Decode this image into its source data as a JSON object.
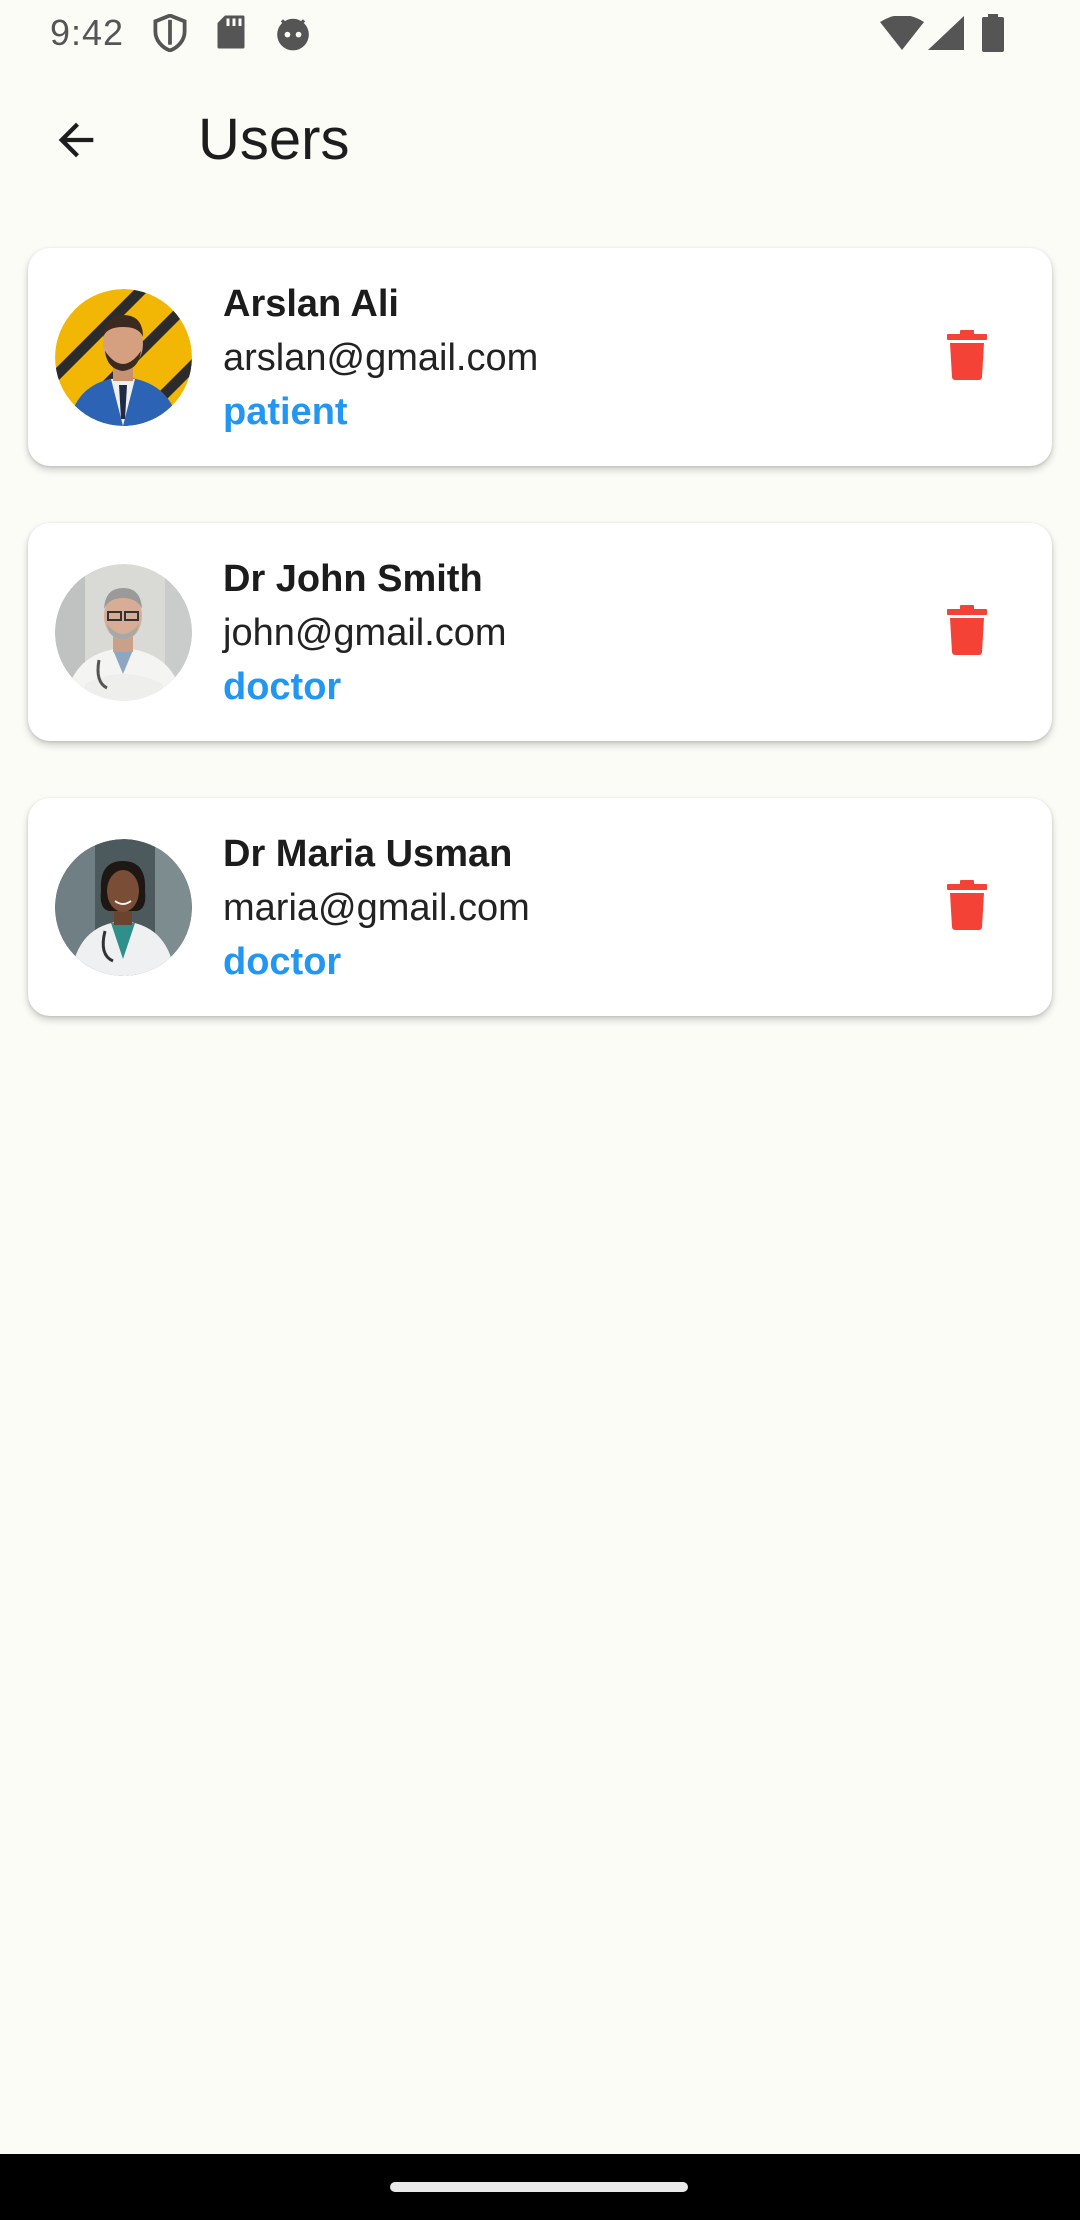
{
  "status_bar": {
    "time": "9:42",
    "left_icons": [
      "shield-icon",
      "sd-card-icon",
      "android-face-icon"
    ],
    "right_icons": [
      "wifi-icon",
      "cellular-signal-icon",
      "battery-icon"
    ]
  },
  "app_bar": {
    "back_icon": "arrow-back-icon",
    "title": "Users"
  },
  "users": [
    {
      "name": "Arslan Ali",
      "email": "arslan@gmail.com",
      "role": "patient"
    },
    {
      "name": "Dr John Smith",
      "email": "john@gmail.com",
      "role": "doctor"
    },
    {
      "name": "Dr Maria Usman",
      "email": "maria@gmail.com",
      "role": "doctor"
    }
  ],
  "colors": {
    "background": "#fcfcf7",
    "role_accent": "#2196f3",
    "delete": "#f44336"
  }
}
